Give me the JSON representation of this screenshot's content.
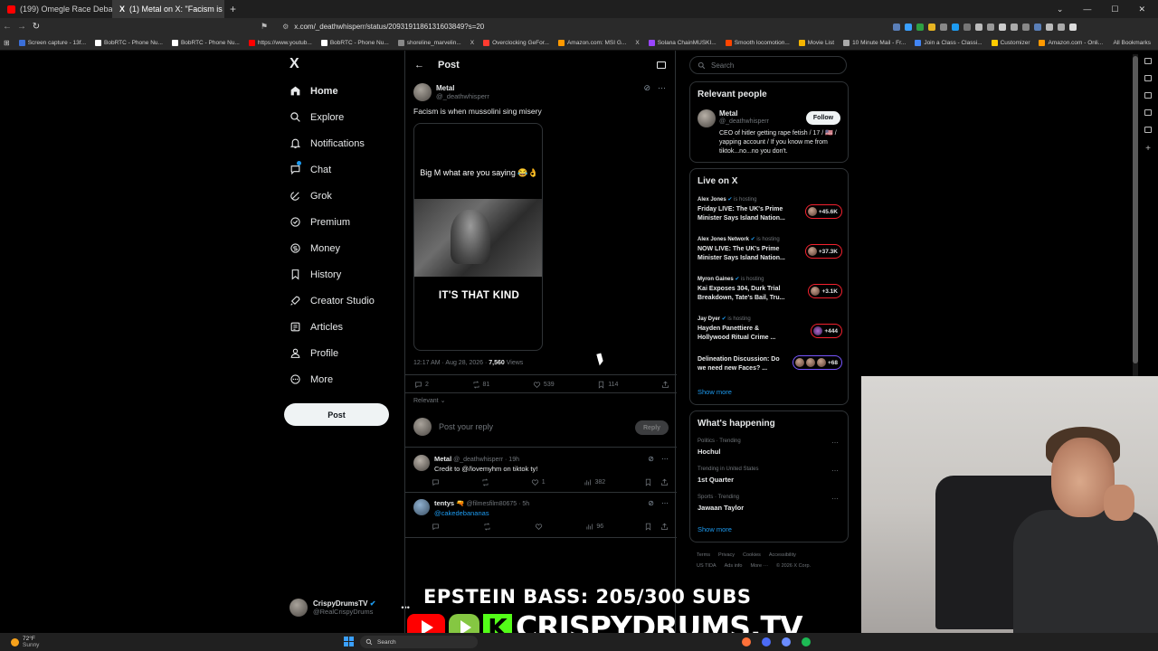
{
  "browser": {
    "tabs": [
      {
        "title": "(199) Omegle Race Debate - YouTub...",
        "favicon_color": "#ff0000",
        "active": false
      },
      {
        "title": "(1) Metal on X: \"Facism is when ...",
        "favicon_color": "#ffffff",
        "active": true
      }
    ],
    "new_tab": "+",
    "url": "x.com/_deathwhisperr/status/2093191186131603849?s=20",
    "bookmarks": [
      {
        "label": "Screen capture - 13f...",
        "color": "#3b6fd8"
      },
      {
        "label": "BobRTC - Phone Nu...",
        "color": "#ffffff"
      },
      {
        "label": "BobRTC - Phone Nu...",
        "color": "#ffffff"
      },
      {
        "label": "https://www.youtub...",
        "color": "#ff0000"
      },
      {
        "label": "BobRTC - Phone Nu...",
        "color": "#ffffff"
      },
      {
        "label": "shoreline_marvelin...",
        "color": "#888888"
      },
      {
        "label": "X",
        "color": "#ffffff"
      },
      {
        "label": "Overclocking GeFor...",
        "color": "#ff3b30"
      },
      {
        "label": "Amazon.com: MSI G...",
        "color": "#ff9900"
      },
      {
        "label": "X",
        "color": "#ffffff"
      },
      {
        "label": "Solana ChainMUSKI...",
        "color": "#9945ff"
      },
      {
        "label": "Smooth locomotion...",
        "color": "#ff4500"
      },
      {
        "label": "Movie List",
        "color": "#f4b400"
      },
      {
        "label": "10 Minute Mail - Fr...",
        "color": "#aaaaaa"
      },
      {
        "label": "Join a Class - Classi...",
        "color": "#4285f4"
      },
      {
        "label": "Customizer",
        "color": "#ffcc00"
      },
      {
        "label": "Amazon.com - Onli...",
        "color": "#ff9900"
      }
    ],
    "all_bookmarks": "All Bookmarks"
  },
  "nav": {
    "logo": "X",
    "items": [
      {
        "label": "Home",
        "icon": "home-icon"
      },
      {
        "label": "Explore",
        "icon": "search-icon"
      },
      {
        "label": "Notifications",
        "icon": "bell-icon"
      },
      {
        "label": "Chat",
        "icon": "chat-icon"
      },
      {
        "label": "Grok",
        "icon": "grok-icon"
      },
      {
        "label": "Premium",
        "icon": "premium-icon"
      },
      {
        "label": "Money",
        "icon": "money-icon"
      },
      {
        "label": "History",
        "icon": "bookmark-icon"
      },
      {
        "label": "Creator Studio",
        "icon": "rocket-icon"
      },
      {
        "label": "Articles",
        "icon": "articles-icon"
      },
      {
        "label": "Profile",
        "icon": "profile-icon"
      },
      {
        "label": "More",
        "icon": "more-icon"
      }
    ],
    "post_button": "Post",
    "account": {
      "name": "CrispyDrumsTV",
      "handle": "@RealCrispyDrums",
      "more": "•••"
    }
  },
  "main": {
    "header_title": "Post",
    "post": {
      "author_name": "Metal",
      "author_handle": "@_deathwhisperr",
      "text": "Facism is when mussolini sing misery",
      "media_caption_top": "Big M what are you saying 😂👌",
      "media_caption_bottom": "IT'S THAT KIND",
      "time": "12:17 AM · Aug 28, 2026 · ",
      "views_count": "7,560",
      "views_label": " Views",
      "replies": "2",
      "reposts": "81",
      "likes": "539",
      "bookmarks": "114"
    },
    "relevant_label": "Relevant ⌄",
    "reply_placeholder": "Post your reply",
    "reply_button": "Reply",
    "replies": [
      {
        "name": "Metal",
        "meta": " @_deathwhisperr · 19h",
        "text": "Credit to @/lovemyhm on tiktok ty!",
        "link": false,
        "replies": "",
        "reposts": "",
        "likes": "1",
        "views": "382"
      },
      {
        "name": "tentys 🔫",
        "meta": " @filmesfilm80675 · 5h",
        "text": "@cakedebananas",
        "link": true,
        "replies": "",
        "reposts": "",
        "likes": "",
        "views": "96"
      }
    ]
  },
  "sidebar": {
    "search_placeholder": "Search",
    "relevant_people": {
      "title": "Relevant people",
      "name": "Metal",
      "handle": "@_deathwhisperr",
      "follow": "Follow",
      "bio": "CEO of hitler getting rape fetish / 17 / 🇺🇸 / yapping account / If you know me from tiktok...no...no you don't."
    },
    "live": {
      "title": "Live on X",
      "items": [
        {
          "host": "Alex Jones",
          "suffix": " is hosting",
          "title": "Friday LIVE: The UK's Prime Minister Says Island Nation...",
          "count": "+45.6K",
          "color": "#f4212e"
        },
        {
          "host": "Alex Jones Network",
          "suffix": " is hosting",
          "title": "NOW LIVE: The UK's Prime Minister Says Island Nation...",
          "count": "+37.3K",
          "color": "#f4212e"
        },
        {
          "host": "Myron Gaines",
          "suffix": " is hosting",
          "title": "Kai Exposes 304, Durk Trial Breakdown, Tate's Bail, Tru...",
          "count": "+3.1K",
          "color": "#f4212e"
        },
        {
          "host": "Jay Dyer",
          "suffix": " is hosting",
          "title": "Hayden Panettiere & Hollywood Ritual Crime ...",
          "count": "+444",
          "color": "#f4212e"
        },
        {
          "host": "",
          "suffix": "",
          "title": "Delineation Discussion: Do we need new Faces? ...",
          "count": "+68",
          "color": "#7856ff"
        }
      ],
      "show_more": "Show more"
    },
    "happening": {
      "title": "What's happening",
      "items": [
        {
          "category": "Politics · Trending",
          "name": "Hochul"
        },
        {
          "category": "Trending in United States",
          "name": "1st Quarter"
        },
        {
          "category": "Sports · Trending",
          "name": "Jawaan Taylor"
        }
      ],
      "show_more": "Show more"
    },
    "footer": [
      "Terms",
      "Privacy",
      "Cookies",
      "Accessibility",
      "US TIDA",
      "Ads info",
      "More ···",
      "© 2026 X Corp."
    ]
  },
  "overlay": {
    "headline": "EPSTEIN BASS: 205/300 SUBS",
    "brand": "CRISPYDRUMS.TV",
    "kick_letter": "K"
  },
  "taskbar": {
    "temp": "72°F",
    "condition": "Sunny",
    "search": "Search"
  }
}
